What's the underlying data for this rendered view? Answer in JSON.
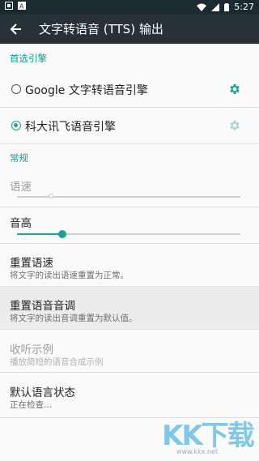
{
  "status_bar": {
    "time": "5:27",
    "left_icons": [
      "app-notification-icon",
      "text-notification-icon"
    ],
    "right_icons": [
      "wifi-icon",
      "cell-signal-icon",
      "battery-icon"
    ]
  },
  "app_bar": {
    "title": "文字转语音 (TTS) 输出",
    "back_icon": "back-arrow-icon"
  },
  "sections": {
    "preferred_engine": "首选引擎",
    "general": "常规"
  },
  "engines": [
    {
      "label": "Google 文字转语音引擎",
      "selected": false,
      "settings_enabled": true
    },
    {
      "label": "科大讯飞语音引擎",
      "selected": true,
      "settings_enabled": false
    }
  ],
  "speech_rate": {
    "label": "语速",
    "enabled": false,
    "value_fraction": 0.15
  },
  "pitch": {
    "label": "音高",
    "enabled": true,
    "value_fraction": 0.2
  },
  "reset_rate": {
    "title": "重置语速",
    "summary": "将文字的读出语速重置为正常。"
  },
  "reset_pitch": {
    "title": "重置语音音调",
    "summary": "将文字的读出音调重置为默认值。"
  },
  "listen_example": {
    "title": "收听示例",
    "summary": "播放简短的语音合成示例"
  },
  "default_language_status": {
    "title": "默认语言状态",
    "summary": "正在检查…"
  },
  "watermark": {
    "text": "KK下载",
    "url": "www.kkx.net"
  },
  "colors": {
    "accent": "#1ba395",
    "app_bar": "#263238",
    "status_bar": "#1b2a31"
  }
}
